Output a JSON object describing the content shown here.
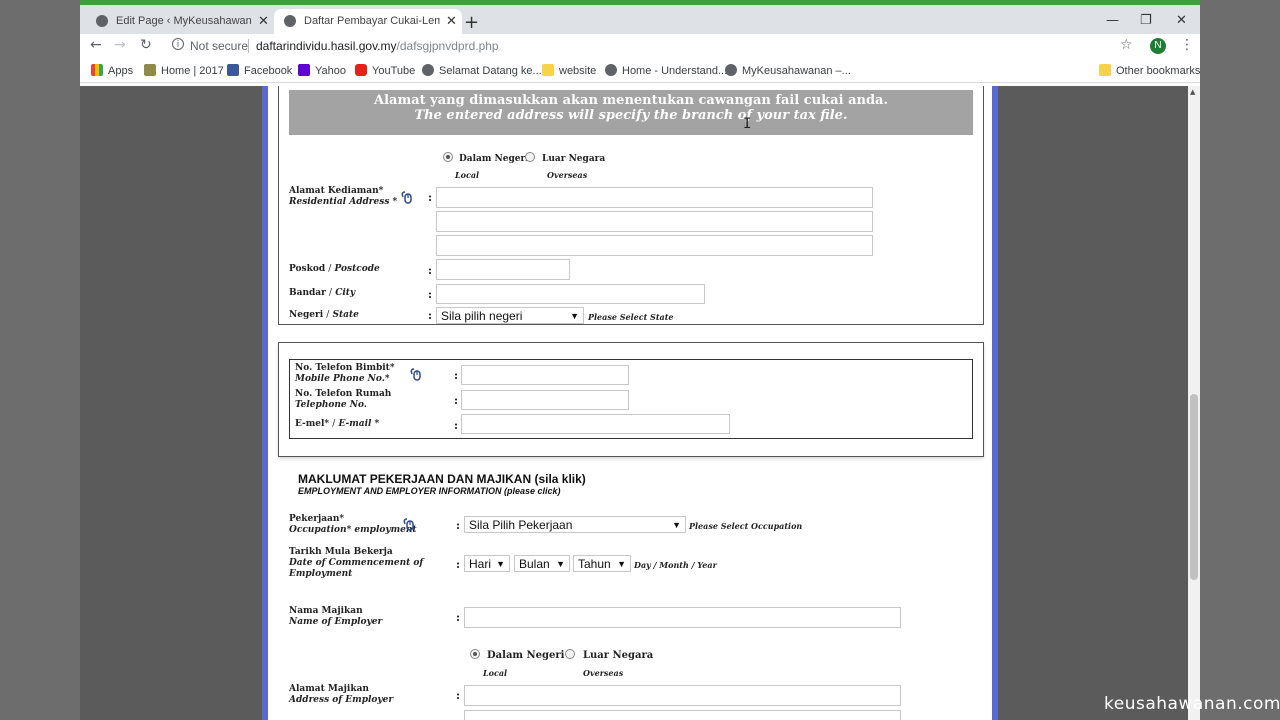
{
  "browser": {
    "tabs": [
      {
        "title": "Edit Page ‹ MyKeusahawanan —",
        "active": false
      },
      {
        "title": "Daftar Pembayar Cukai-Lembaga",
        "active": true
      }
    ],
    "address": {
      "security": "Not secure",
      "host": "daftarindividu.hasil.gov.my",
      "path": "/dafsgjpnvdprd.php"
    },
    "avatar_letter": "N",
    "bookmarks": [
      "Apps",
      "Home | 2017",
      "Facebook",
      "Yahoo",
      "YouTube",
      "Selamat Datang ke...",
      "website",
      "Home - Understand...",
      "MyKeusahawanan –..."
    ],
    "other_bookmarks": "Other bookmarks",
    "accent": "#3f9f3f"
  },
  "address_section": {
    "banner_line1": "Alamat yang dimasukkan akan menentukan cawangan fail cukai anda.",
    "banner_line2": "The entered address will specify the branch of your tax file.",
    "banner_color": "#a3a3a3",
    "location_options": [
      {
        "label": "Dalam Negeri",
        "sub": "Local",
        "selected": true
      },
      {
        "label": "Luar Negara",
        "sub": "Overseas",
        "selected": false
      }
    ],
    "residential_label": "Alamat Kediaman*",
    "residential_label_en": "Residential Address *",
    "postcode_label": "Poskod",
    "postcode_label_en": "Postcode",
    "city_label": "Bandar",
    "city_label_en": "City",
    "state_label": "Negeri",
    "state_label_en": "State",
    "state_value": "Sila pilih negeri",
    "state_hint": "Please Select State"
  },
  "contact_section": {
    "mobile_label": "No. Telefon Bimbit*",
    "mobile_label_en": "Mobile Phone No.*",
    "phone_label": "No. Telefon Rumah",
    "phone_label_en": "Telephone No.",
    "email_label": "E-mel*",
    "email_label_en": "E-mail *"
  },
  "employment_section": {
    "heading": "MAKLUMAT PEKERJAAN DAN MAJIKAN (sila klik)",
    "heading_en": "EMPLOYMENT AND EMPLOYER INFORMATION (please click)",
    "occupation_label": "Pekerjaan*",
    "occupation_label_en": "Occupation* employment",
    "occupation_value": "Sila Pilih Pekerjaan",
    "occupation_hint": "Please Select Occupation",
    "start_label": "Tarikh Mula Bekerja",
    "start_label_en_1": "Date of Commencement of",
    "start_label_en_2": "Employment",
    "day_value": "Hari",
    "month_value": "Bulan",
    "year_value": "Tahun",
    "date_hint": "Day / Month / Year",
    "employer_label": "Nama Majikan",
    "employer_label_en": "Name of Employer",
    "employer_location_options": [
      {
        "label": "Dalam Negeri",
        "sub": "Local",
        "selected": true
      },
      {
        "label": "Luar Negara",
        "sub": "Overseas",
        "selected": false
      }
    ],
    "employer_address_label": "Alamat Majikan",
    "employer_address_label_en": "Address of Employer"
  },
  "colon": ":",
  "slash": "/",
  "watermark": "keusahawanan.com"
}
